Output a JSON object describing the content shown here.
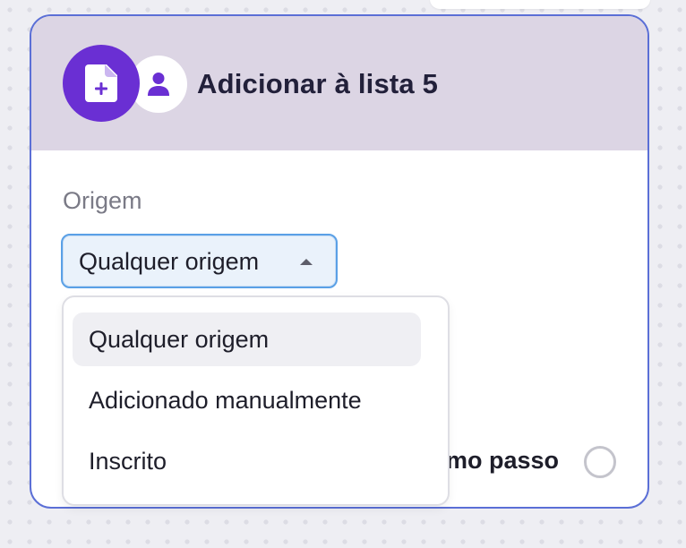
{
  "card": {
    "title": "Adicionar à lista 5",
    "icons": {
      "primary": "add-to-list-document-icon",
      "secondary": "user-icon"
    },
    "colors": {
      "header_background": "#dcd5e4",
      "primary_icon_background": "#6a2fd3",
      "border": "#5b6fd6"
    }
  },
  "origin_field": {
    "label": "Origem",
    "selected_value": "Qualquer origem",
    "expanded": true,
    "options": [
      {
        "label": "Qualquer origem",
        "selected": true
      },
      {
        "label": "Adicionado manualmente",
        "selected": false
      },
      {
        "label": "Inscrito",
        "selected": false
      }
    ]
  },
  "next_step": {
    "label_visible_fragment": "mo passo",
    "checked": false
  }
}
